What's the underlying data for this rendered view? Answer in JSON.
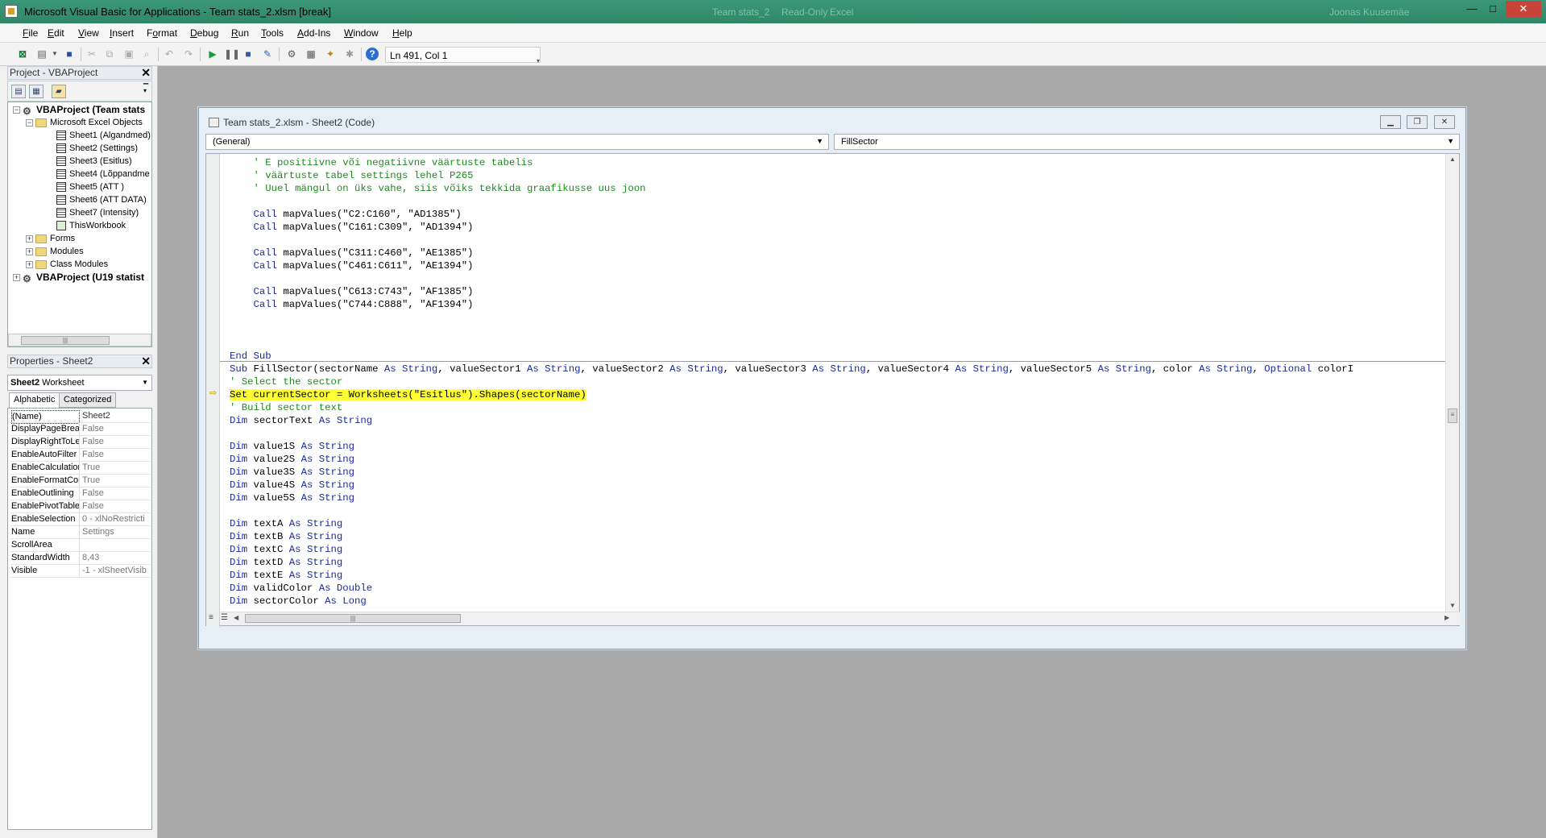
{
  "window": {
    "title": "Microsoft Visual Basic for Applications - Team stats_2.xlsm [break]",
    "ghost_left": "Team stats_2",
    "ghost_mid": "Read-Only",
    "ghost_right": "Excel",
    "ghost_user": "Joonas Kuusemäe",
    "minimize": "—",
    "maximize": "□",
    "close": "✕"
  },
  "menu": {
    "file": {
      "m": "F",
      "r": "ile"
    },
    "edit": {
      "m": "E",
      "r": "dit"
    },
    "view": {
      "m": "V",
      "r": "iew"
    },
    "insert": {
      "m": "I",
      "r": "nsert"
    },
    "format": {
      "l": "F",
      "m": "o",
      "r": "rmat"
    },
    "debug": {
      "m": "D",
      "r": "ebug"
    },
    "run": {
      "m": "R",
      "r": "un"
    },
    "tools": {
      "m": "T",
      "r": "ools"
    },
    "addins": {
      "m": "A",
      "r": "dd-Ins"
    },
    "window": {
      "m": "W",
      "r": "indow"
    },
    "help": {
      "m": "H",
      "r": "elp"
    }
  },
  "toolbar": {
    "position": "Ln 491, Col 1"
  },
  "project_panel": {
    "title": "Project - VBAProject",
    "close": "✕",
    "tree": {
      "root1": "VBAProject (Team stats",
      "excel_objects": "Microsoft Excel Objects",
      "sheet1": "Sheet1 (Algandmed)",
      "sheet2": "Sheet2 (Settings)",
      "sheet3": "Sheet3 (Esitlus)",
      "sheet4": "Sheet4 (Lõppandme",
      "sheet5": "Sheet5 (ATT )",
      "sheet6": "Sheet6 (ATT DATA)",
      "sheet7": "Sheet7 (Intensity)",
      "thisworkbook": "ThisWorkbook",
      "forms": "Forms",
      "modules": "Modules",
      "class_modules": "Class Modules",
      "root2": "VBAProject (U19 statist"
    }
  },
  "properties_panel": {
    "title": "Properties - Sheet2",
    "close": "✕",
    "object_name": "Sheet2",
    "object_type": "Worksheet",
    "tab_alphabetic": "Alphabetic",
    "tab_categorized": "Categorized",
    "rows": [
      {
        "k": "(Name)",
        "v": "Sheet2"
      },
      {
        "k": "DisplayPageBreak",
        "v": "False"
      },
      {
        "k": "DisplayRightToLef",
        "v": "False"
      },
      {
        "k": "EnableAutoFilter",
        "v": "False"
      },
      {
        "k": "EnableCalculation",
        "v": "True"
      },
      {
        "k": "EnableFormatCon",
        "v": "True"
      },
      {
        "k": "EnableOutlining",
        "v": "False"
      },
      {
        "k": "EnablePivotTable",
        "v": "False"
      },
      {
        "k": "EnableSelection",
        "v": "0 - xlNoRestricti"
      },
      {
        "k": "Name",
        "v": "Settings"
      },
      {
        "k": "ScrollArea",
        "v": ""
      },
      {
        "k": "StandardWidth",
        "v": "8,43"
      },
      {
        "k": "Visible",
        "v": "-1 - xlSheetVisib"
      }
    ]
  },
  "code_window": {
    "title": "Team stats_2.xlsm - Sheet2 (Code)",
    "object_combo": "(General)",
    "proc_combo": "FillSector",
    "lines": {
      "l1": "    ' E positiivne või negatiivne väärtuste tabelis",
      "l2": "    ' väärtuste tabel settings lehel P265",
      "l3": "    ' Uuel mängul on üks vahe, siis võiks tekkida graafikusse uus joon",
      "l5_kw": "    Call",
      "l5_rest": " mapValues(\"C2:C160\", \"AD1385\")",
      "l6_kw": "    Call",
      "l6_rest": " mapValues(\"C161:C309\", \"AD1394\")",
      "l8_kw": "    Call",
      "l8_rest": " mapValues(\"C311:C460\", \"AE1385\")",
      "l9_kw": "    Call",
      "l9_rest": " mapValues(\"C461:C611\", \"AE1394\")",
      "l11_kw": "    Call",
      "l11_rest": " mapValues(\"C613:C743\", \"AF1385\")",
      "l12_kw": "    Call",
      "l12_rest": " mapValues(\"C744:C888\", \"AF1394\")",
      "endsub": "End Sub",
      "sub_a": "Sub",
      "sub_b": " FillSector(sectorName ",
      "as": "As",
      "string": "String",
      "sub_c": ", valueSector1 ",
      "sub_d": ", valueSector2 ",
      "sub_e": ", valueSector3 ",
      "sub_f": ", valueSector4 ",
      "sub_g": ", valueSector5 ",
      "sub_h": ", color ",
      "optional": "Optional",
      "sub_i": " colorI",
      "sel_comment": "' Select the sector",
      "set_line": "Set currentSector = Worksheets(\"Esitlus\").Shapes(sectorName)",
      "build_comment": "' Build sector text",
      "dim": "Dim",
      "v_sectorText": " sectorText ",
      "v_value1S": " value1S ",
      "v_value2S": " value2S ",
      "v_value3S": " value3S ",
      "v_value4S": " value4S ",
      "v_value5S": " value5S ",
      "v_textA": " textA ",
      "v_textB": " textB ",
      "v_textC": " textC ",
      "v_textD": " textD ",
      "v_textE": " textE ",
      "v_validColor": " validColor ",
      "double": "Double",
      "v_sectorColor": " sectorColor ",
      "long": "Long"
    }
  },
  "colors": {
    "comment": "#1e8a1e",
    "keyword": "#1a2b9c",
    "highlight": "#ffff33",
    "titlebar": "#2f8767"
  }
}
